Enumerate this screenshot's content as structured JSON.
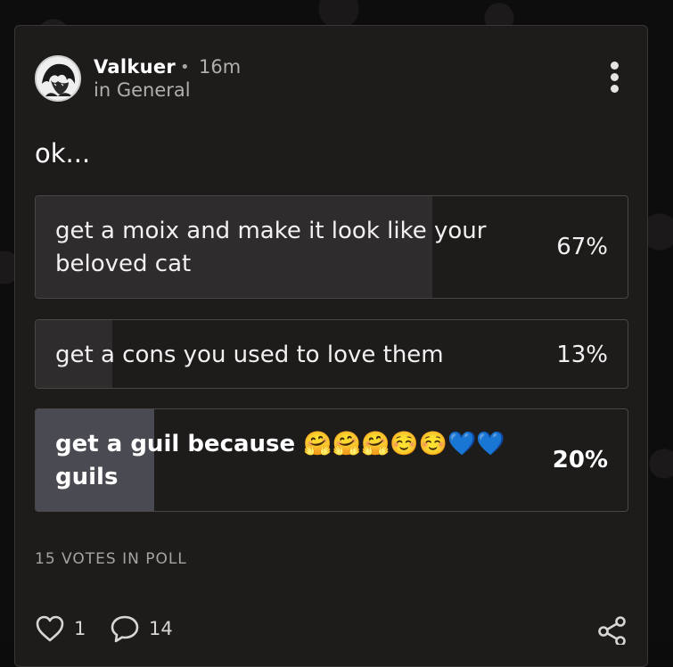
{
  "post": {
    "author": "Valkuer",
    "separator": "•",
    "time_ago": "16m",
    "category": "in General",
    "body": "ok..."
  },
  "poll": {
    "options": [
      {
        "label": "get a moix and make it look like your beloved cat",
        "percent_text": "67%",
        "percent": 67,
        "selected": false
      },
      {
        "label": "get a cons you used to love them",
        "percent_text": "13%",
        "percent": 13,
        "selected": false
      },
      {
        "label": "get a guil because 🤗🤗🤗☺️☺️💙💙 guils",
        "percent_text": "20%",
        "percent": 20,
        "selected": true
      }
    ],
    "votes_label": "15 VOTES IN POLL"
  },
  "actions": {
    "likes": "1",
    "comments": "14"
  },
  "icons": {
    "more": "more-vertical-icon",
    "like": "heart-icon",
    "comment": "comment-icon",
    "share": "share-icon"
  }
}
